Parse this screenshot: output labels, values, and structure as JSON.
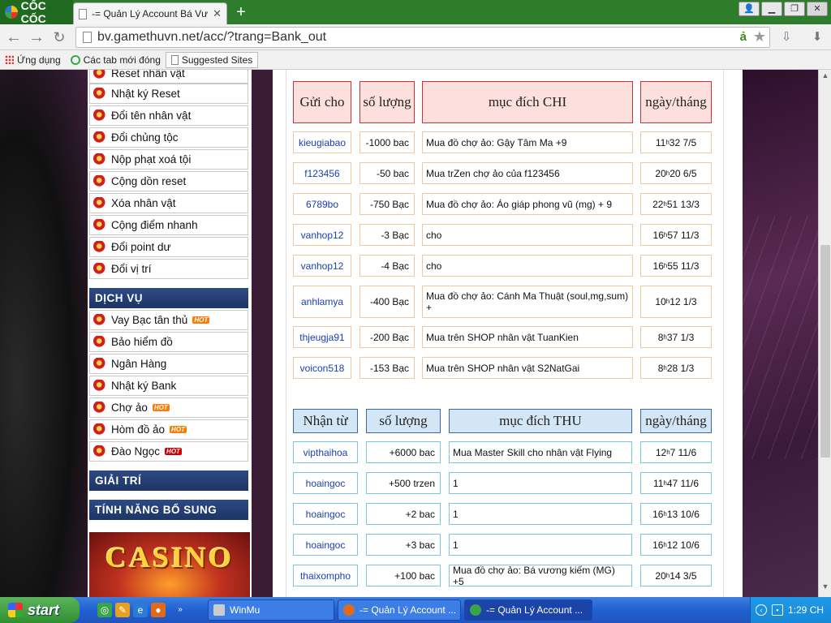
{
  "browser": {
    "brand": "CỐC CỐC",
    "tab_title": "-= Quản Lý Account Bá Vương",
    "url": "bv.gamethuvn.net/acc/?trang=Bank_out",
    "bookmarks": [
      "Ứng dụng",
      "Các tab mới đóng",
      "Suggested Sites"
    ]
  },
  "sidebar": {
    "items_top": [
      "Reset nhân vật",
      "Nhật ký Reset",
      "Đổi tên nhân vật",
      "Đổi chủng tộc",
      "Nộp phạt xoá tội",
      "Cộng dồn reset",
      "Xóa nhân vật",
      "Cộng điểm nhanh",
      "Đổi point dư",
      "Đổi vị trí"
    ],
    "section_dichvu": "DỊCH VỤ",
    "items_dichvu": [
      "Vay Bạc tân thủ",
      "Bảo hiểm đồ",
      "Ngân Hàng",
      "Nhật ký Bank",
      "Chợ ảo",
      "Hòm đồ ảo",
      "Đào Ngọc"
    ],
    "hot_label": "HOT",
    "section_giaitri": "GIẢI TRÍ",
    "section_tinhnang": "TÍNH NĂNG BỔ SUNG",
    "casino_text": "CASINO"
  },
  "chi_table": {
    "headers": [
      "Gửi cho",
      "số lượng",
      "mục đích CHI",
      "ngày/tháng"
    ],
    "rows": [
      {
        "user": "kieugiabao",
        "amount": "-1000  bac",
        "purpose": "Mua đồ chợ ảo: Gậy Tâm Ma +9",
        "h": "11",
        "m": "32 7/5"
      },
      {
        "user": "f123456",
        "amount": "-50  bac",
        "purpose": "Mua trZen chợ ảo của f123456",
        "h": "20",
        "m": "20 6/5"
      },
      {
        "user": "6789bo",
        "amount": "-750  Bạc",
        "purpose": "Mua đồ chợ ảo: Áo giáp phong vũ (mg) + 9",
        "h": "22",
        "m": "51 13/3"
      },
      {
        "user": "vanhop12",
        "amount": "-3  Bạc",
        "purpose": "cho",
        "h": "16",
        "m": "57 11/3"
      },
      {
        "user": "vanhop12",
        "amount": "-4  Bạc",
        "purpose": "cho",
        "h": "16",
        "m": "55 11/3"
      },
      {
        "user": "anhlamya",
        "amount": "-400  Bạc",
        "purpose": "Mua đồ chợ ảo: Cánh Ma Thuật (soul,mg,sum) +",
        "h": "10",
        "m": "12 1/3"
      },
      {
        "user": "thjeugja91",
        "amount": "-200  Bạc",
        "purpose": "Mua trên SHOP nhân vật TuanKien",
        "h": "8",
        "m": "37 1/3"
      },
      {
        "user": "voicon518",
        "amount": "-153  Bạc",
        "purpose": "Mua trên SHOP nhân vật S2NatGai",
        "h": "8",
        "m": "28 1/3"
      }
    ]
  },
  "thu_table": {
    "headers": [
      "Nhận từ",
      "số lượng",
      "mục đích THU",
      "ngày/tháng"
    ],
    "rows": [
      {
        "user": "vipthaihoa",
        "amount": "+6000  bac",
        "purpose": "Mua Master Skill cho nhân vật Flying",
        "h": "12",
        "m": "7 11/6"
      },
      {
        "user": "hoaingoc",
        "amount": "+500  trzen",
        "purpose": "1",
        "h": "11",
        "m": "47 11/6"
      },
      {
        "user": "hoaingoc",
        "amount": "+2  bac",
        "purpose": "1",
        "h": "16",
        "m": "13 10/6"
      },
      {
        "user": "hoaingoc",
        "amount": "+3  bac",
        "purpose": "1",
        "h": "16",
        "m": "12 10/6"
      },
      {
        "user": "thaixompho",
        "amount": "+100  bac",
        "purpose": "Mua đồ chợ ảo: Bá vương kiếm (MG) +5",
        "h": "20",
        "m": "14 3/5"
      }
    ]
  },
  "taskbar": {
    "start": "start",
    "items": [
      "WinMu",
      "-= Quản Lý Account ...",
      "-= Quản Lý Account ..."
    ],
    "clock": "1:29 CH"
  },
  "hour_mark": "h"
}
